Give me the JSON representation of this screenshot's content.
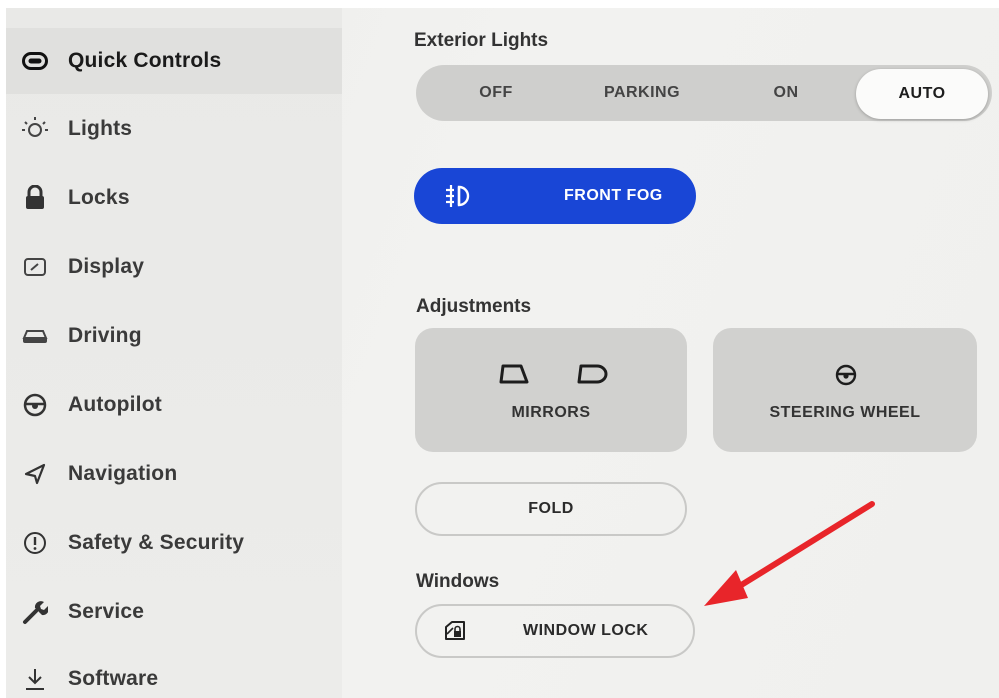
{
  "sidebar": {
    "items": [
      {
        "label": "Quick Controls",
        "icon": "toggle-icon",
        "active": true
      },
      {
        "label": "Lights",
        "icon": "bulb-icon"
      },
      {
        "label": "Locks",
        "icon": "lock-icon"
      },
      {
        "label": "Display",
        "icon": "display-icon"
      },
      {
        "label": "Driving",
        "icon": "car-icon"
      },
      {
        "label": "Autopilot",
        "icon": "steering-wheel-icon"
      },
      {
        "label": "Navigation",
        "icon": "navigation-arrow-icon"
      },
      {
        "label": "Safety & Security",
        "icon": "alert-circle-icon"
      },
      {
        "label": "Service",
        "icon": "wrench-icon"
      },
      {
        "label": "Software",
        "icon": "download-icon"
      }
    ]
  },
  "exterior_lights": {
    "title": "Exterior Lights",
    "options": [
      "OFF",
      "PARKING",
      "ON",
      "AUTO"
    ],
    "selected": "AUTO"
  },
  "fog": {
    "label": "FRONT FOG",
    "active": true,
    "color": "#1946d6"
  },
  "adjustments": {
    "title": "Adjustments",
    "mirrors_label": "MIRRORS",
    "steering_label": "STEERING WHEEL",
    "fold_label": "FOLD"
  },
  "windows": {
    "title": "Windows",
    "lock_label": "WINDOW LOCK"
  },
  "annotation": {
    "arrow_color": "#e8252a"
  }
}
